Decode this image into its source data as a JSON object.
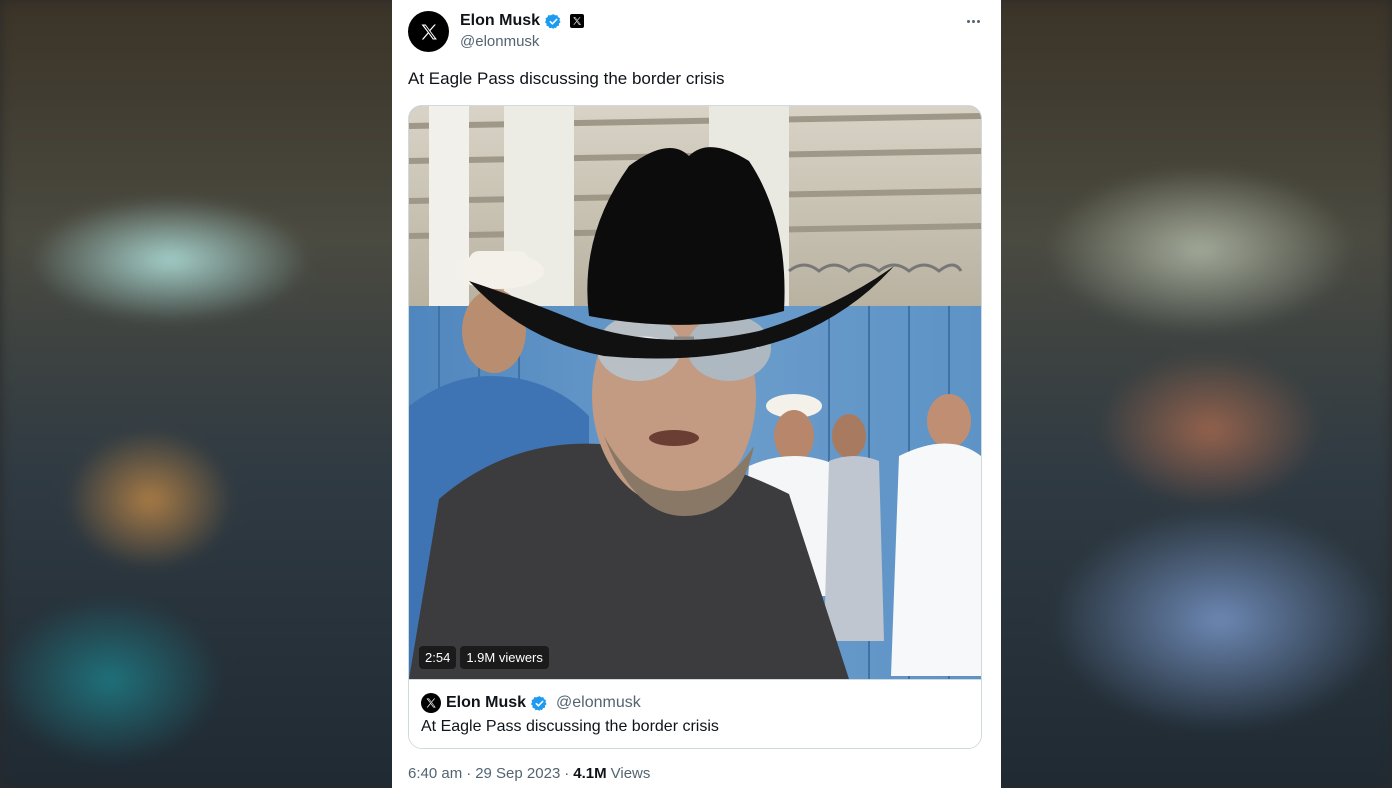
{
  "tweet": {
    "author": {
      "name": "Elon Musk",
      "handle": "@elonmusk",
      "avatar_icon": "x-logo-icon",
      "verified_icon": "verified-badge-icon",
      "affiliate_icon": "x-affiliate-badge-icon"
    },
    "more_icon": "more-dots-icon",
    "text": "At Eagle Pass discussing the border crisis",
    "video": {
      "duration": "2:54",
      "viewers": "1.9M viewers"
    },
    "quote": {
      "name": "Elon Musk",
      "handle": "@elonmusk",
      "text": "At Eagle Pass discussing the border crisis"
    },
    "meta": {
      "time": "6:40 am",
      "separator1": "·",
      "date": "29 Sep 2023",
      "separator2": "·",
      "views_count": "4.1M",
      "views_label": "Views"
    }
  },
  "colors": {
    "text_primary": "#0f1419",
    "text_secondary": "#536471",
    "verified_blue": "#1d9bf0",
    "border": "#cfd9de"
  }
}
